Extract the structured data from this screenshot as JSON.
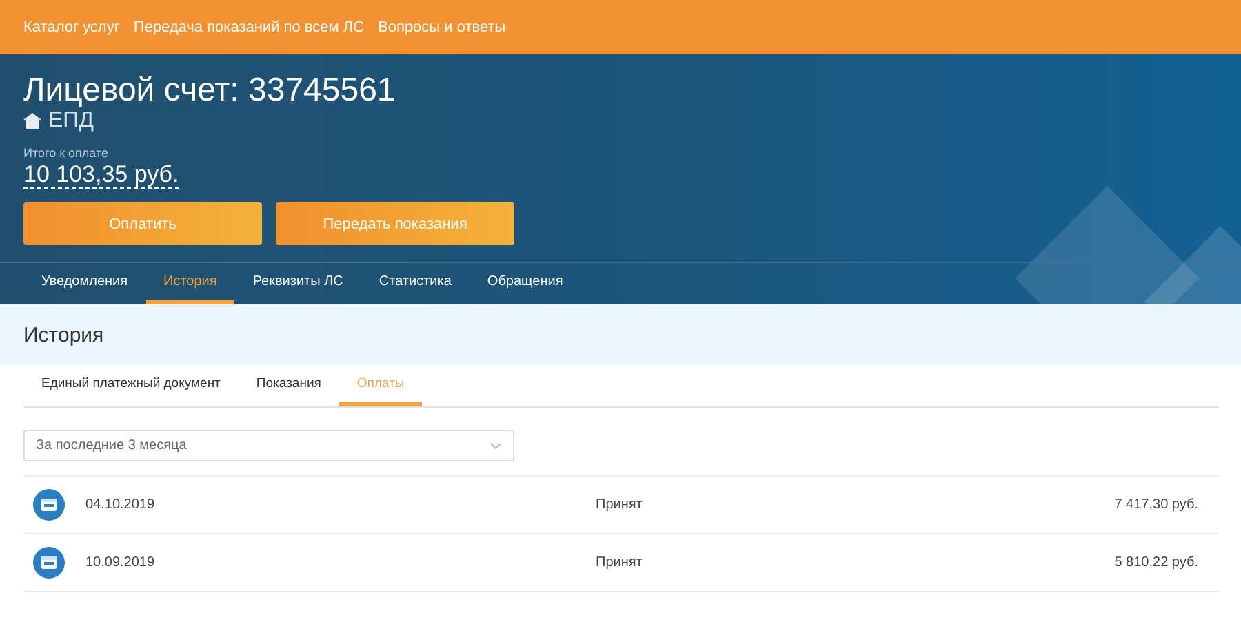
{
  "top_nav": [
    "Каталог услуг",
    "Передача показаний по всем ЛС",
    "Вопросы и ответы"
  ],
  "account": {
    "title": "Лицевой счет: 33745561",
    "type": "ЕПД",
    "total_label": "Итого к оплате",
    "total": "10 103,35 руб."
  },
  "actions": [
    "Оплатить",
    "Передать показания"
  ],
  "tabs": [
    {
      "label": "Уведомления",
      "selected": false
    },
    {
      "label": "История",
      "selected": true
    },
    {
      "label": "Реквизиты ЛС",
      "selected": false
    },
    {
      "label": "Статистика",
      "selected": false
    },
    {
      "label": "Обращения",
      "selected": false
    }
  ],
  "section_title": "История",
  "subtabs": [
    {
      "label": "Единый платежный документ",
      "selected": false
    },
    {
      "label": "Показания",
      "selected": false
    },
    {
      "label": "Оплаты",
      "selected": true
    }
  ],
  "period_select": {
    "value": "За последние 3 месяца"
  },
  "payments": [
    {
      "date": "04.10.2019",
      "status": "Принят",
      "amount": "7 417,30 руб."
    },
    {
      "date": "10.09.2019",
      "status": "Принят",
      "amount": "5 810,22 руб."
    }
  ]
}
